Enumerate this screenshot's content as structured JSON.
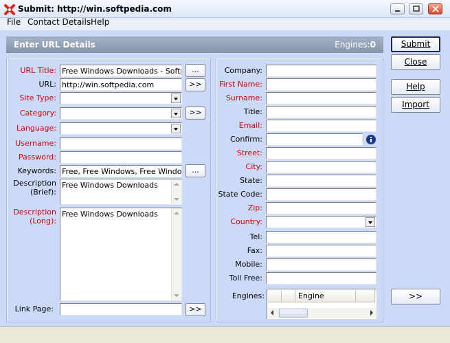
{
  "window": {
    "title": "Submit: http://win.softpedia.com"
  },
  "menu": {
    "file": "File",
    "contact_details": "Contact Details",
    "help": "Help"
  },
  "header": {
    "title": "Enter URL Details",
    "engines_label": "Engines:",
    "engines_count": "0"
  },
  "url_details": {
    "url_title_label": "URL Title:",
    "url_title_value": "Free Windows Downloads - Softpedia",
    "url_label": "URL:",
    "url_value": "http://win.softpedia.com",
    "site_type_label": "Site Type:",
    "category_label": "Category:",
    "language_label": "Language:",
    "username_label": "Username:",
    "password_label": "Password:",
    "keywords_label": "Keywords:",
    "keywords_value": "Free, Free Windows, Free Windows Downloads",
    "description_brief_label_1": "Description",
    "description_brief_label_2": "(Brief):",
    "description_brief_value": "Free Windows Downloads",
    "description_long_label_1": "Description",
    "description_long_label_2": "(Long):",
    "description_long_value": "Free Windows Downloads",
    "link_page_label": "Link Page:",
    "browse_label": "...",
    "next_label": ">>"
  },
  "contact": {
    "company_label": "Company:",
    "first_name_label": "First Name:",
    "surname_label": "Surname:",
    "title_label": "Title:",
    "email_label": "Email:",
    "confirm_label": "Confirm:",
    "street_label": "Street:",
    "city_label": "City:",
    "state_label": "State:",
    "state_code_label": "State Code:",
    "zip_label": "Zip:",
    "country_label": "Country:",
    "tel_label": "Tel:",
    "fax_label": "Fax:",
    "mobile_label": "Mobile:",
    "toll_free_label": "Toll Free:",
    "engines_label": "Engines:",
    "engine_column": "Engine"
  },
  "buttons": {
    "submit": "Submit",
    "close": "Close",
    "help": "Help",
    "import": "Import",
    "forward": ">>"
  },
  "colors": {
    "required": "#cc0000",
    "background": "#ccdaf8",
    "header": "#8f9bb1"
  }
}
